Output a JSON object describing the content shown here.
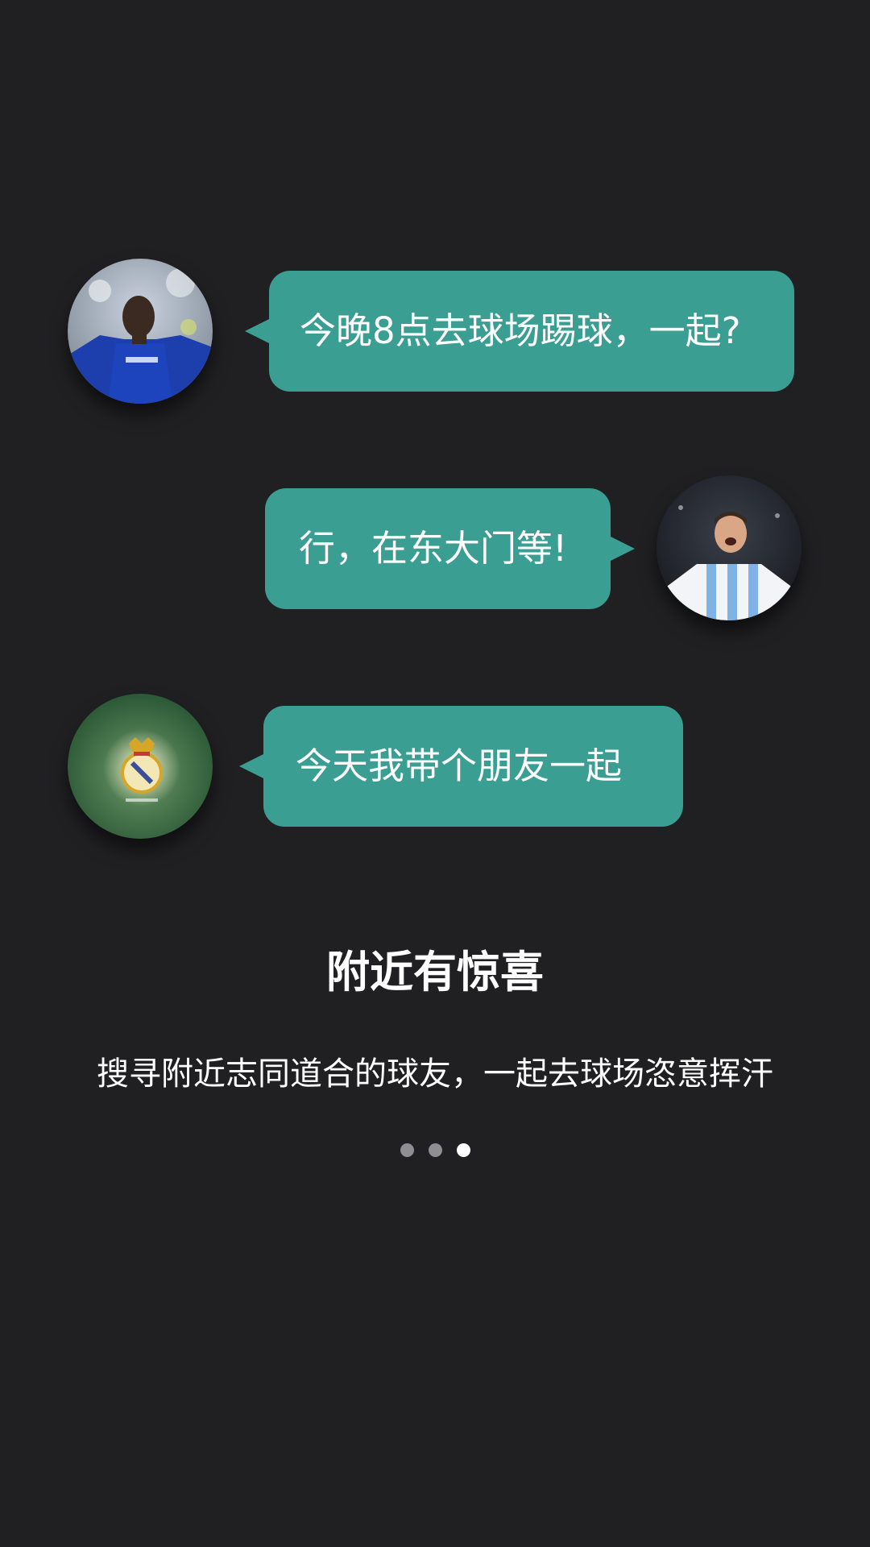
{
  "messages": [
    {
      "text": "今晚8点去球场踢球，一起?",
      "side": "left",
      "avatar": "player-blue-jersey-avatar"
    },
    {
      "text": "行，在东大门等!",
      "side": "right",
      "avatar": "player-striped-jersey-avatar"
    },
    {
      "text": "今天我带个朋友一起",
      "side": "left",
      "avatar": "club-crest-on-grass-avatar"
    }
  ],
  "feature": {
    "title": "附近有惊喜",
    "subtitle": "搜寻附近志同道合的球友，一起去球场恣意挥汗"
  },
  "pager": {
    "count": 3,
    "active_index": 2
  },
  "colors": {
    "background": "#201f22",
    "bubble": "#3a9e92",
    "dot_inactive": "#8f8f93",
    "dot_active": "#ffffff"
  }
}
